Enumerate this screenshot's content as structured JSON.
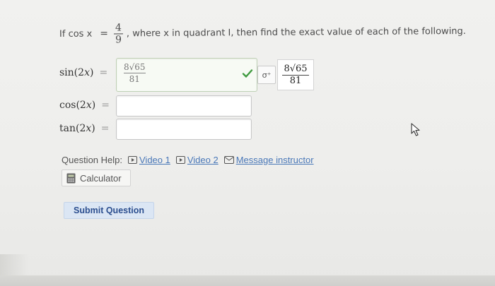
{
  "prompt": {
    "prefix": "If cos x",
    "eq": "=",
    "frac_num": "4",
    "frac_den": "9",
    "suffix": ", where x in quadrant I, then find the exact value of each of the following."
  },
  "rows": [
    {
      "label": "sin(2x)",
      "eq": "=",
      "value_num": "8√65",
      "value_den": "81",
      "status": "correct",
      "preview_num": "8√65",
      "preview_den": "81"
    },
    {
      "label": "cos(2x)",
      "eq": "=",
      "value": ""
    },
    {
      "label": "tan(2x)",
      "eq": "=",
      "value": ""
    }
  ],
  "preview_icon": "σ⁺",
  "help": {
    "label": "Question Help:",
    "video1": "Video 1",
    "video2": "Video 2",
    "message": "Message instructor"
  },
  "calculator": "Calculator",
  "submit": "Submit Question",
  "colors": {
    "link": "#4a78b8",
    "correct": "#3f9a3f",
    "submit_bg": "#dbe6f4",
    "submit_text": "#2c4f8f"
  },
  "icons": {
    "check": "check-icon",
    "video": "video-play-icon",
    "message": "envelope-icon",
    "calculator": "calculator-icon",
    "cursor": "mouse-pointer-icon"
  }
}
